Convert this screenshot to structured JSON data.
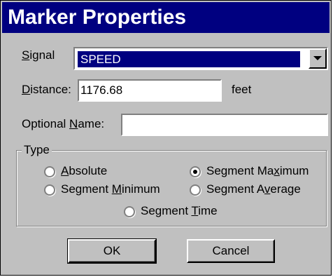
{
  "window": {
    "title": "Marker Properties"
  },
  "signal": {
    "label_pre": "",
    "label_key": "S",
    "label_post": "ignal",
    "selected": "SPEED"
  },
  "distance": {
    "label_key": "D",
    "label_post": "istance:",
    "value": "1176.68",
    "unit": "feet"
  },
  "optional_name": {
    "label_pre": "Optional ",
    "label_key": "N",
    "label_post": "ame:",
    "value": ""
  },
  "type_group": {
    "title": "Type",
    "options": [
      {
        "pre": "",
        "key": "A",
        "post": "bsolute",
        "checked": false
      },
      {
        "pre": "Segment Ma",
        "key": "x",
        "post": "imum",
        "checked": true
      },
      {
        "pre": "Segment ",
        "key": "M",
        "post": "inimum",
        "checked": false
      },
      {
        "pre": "Segment A",
        "key": "v",
        "post": "erage",
        "checked": false
      },
      {
        "pre": "Segment ",
        "key": "T",
        "post": "ime",
        "checked": false
      }
    ]
  },
  "buttons": {
    "ok": "OK",
    "cancel": "Cancel"
  }
}
